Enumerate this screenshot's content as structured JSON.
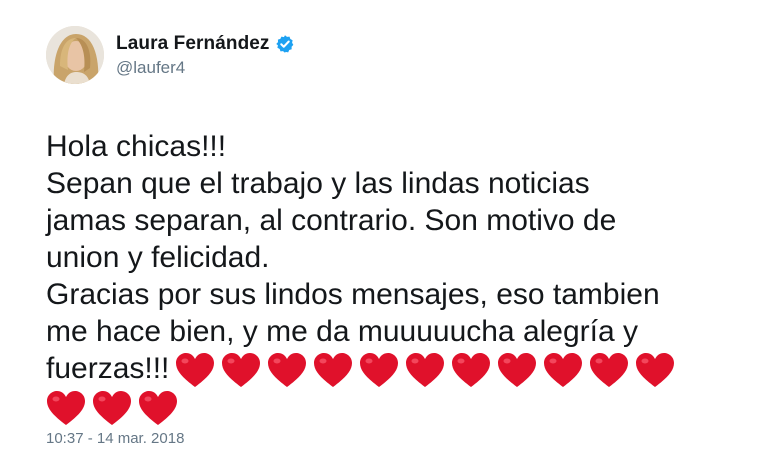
{
  "user": {
    "display_name": "Laura Fernández",
    "handle": "@laufer4",
    "verified": true,
    "verified_color": "#1da1f2"
  },
  "tweet": {
    "lines": [
      "Hola chicas!!!",
      "Sepan que el trabajo y las lindas noticias",
      "jamas separan, al contrario. Son motivo de",
      "union y felicidad.",
      "Gracias por sus lindos mensajes, eso tambien",
      "me hace bien, y me da muuuuucha alegría y",
      "fuerzas!!!"
    ],
    "heart_color": "#e0112b",
    "hearts_line1": 11,
    "hearts_line2": 3,
    "emoji": "heart-icon"
  },
  "timestamp": "10:37 - 14 mar. 2018"
}
